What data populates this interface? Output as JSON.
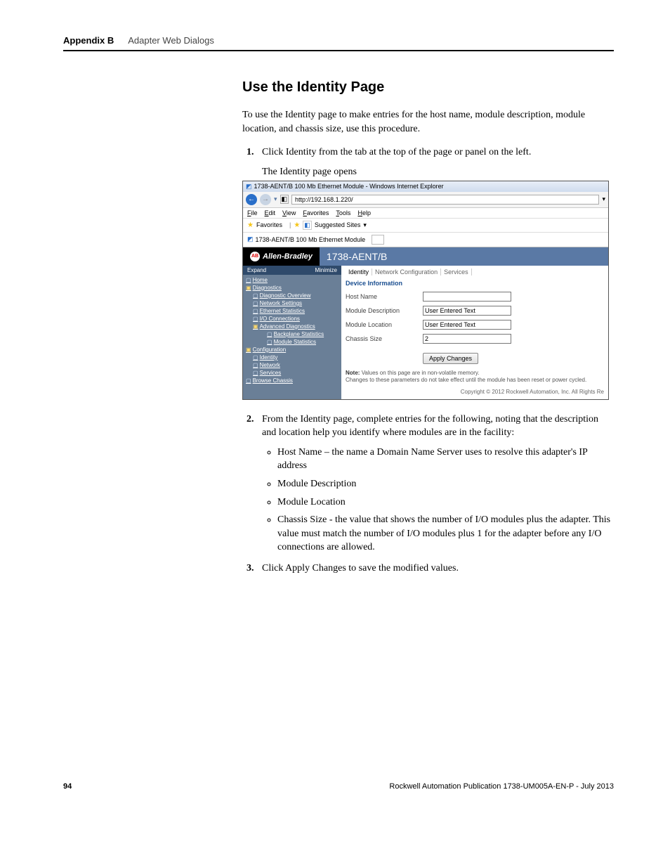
{
  "header": {
    "appendix": "Appendix B",
    "title": "Adapter Web Dialogs"
  },
  "section": {
    "heading": "Use the Identity Page",
    "intro": "To use the Identity page to make entries for the host name, module description, module location, and chassis size, use this procedure.",
    "step1": "Click Identity from the tab at the top of the page or panel on the left.",
    "caption": "The Identity page opens",
    "step2": "From the Identity page, complete entries for the following, noting that the description and location help you identify where modules are in the facility:",
    "bullets": {
      "b1": "Host Name – the name a Domain Name Server uses to resolve this adapter's IP address",
      "b2": "Module Description",
      "b3": "Module Location",
      "b4": "Chassis Size - the value that shows the number of I/O modules plus the adapter. This value must match the number of I/O modules plus 1 for the adapter before any I/O connections are allowed."
    },
    "step3": "Click Apply Changes to save the modified values."
  },
  "screenshot": {
    "window_title": "1738-AENT/B 100 Mb Ethernet Module - Windows Internet Explorer",
    "url": "http://192.168.1.220/",
    "menu": {
      "file": "File",
      "edit": "Edit",
      "view": "View",
      "favorites": "Favorites",
      "tools": "Tools",
      "help": "Help"
    },
    "favbar": {
      "label": "Favorites",
      "suggested": "Suggested Sites"
    },
    "tab_label": "1738-AENT/B 100 Mb Ethernet Module",
    "brand": {
      "left": "Allen-Bradley",
      "right": "1738-AENT/B"
    },
    "side": {
      "expand": "Expand",
      "minimize": "Minimize",
      "home": "Home",
      "diagnostics": "Diagnostics",
      "diag_overview": "Diagnostic Overview",
      "net_settings": "Network Settings",
      "eth_stats": "Ethernet Statistics",
      "io_conn": "I/O Connections",
      "adv_diag": "Advanced Diagnostics",
      "backplane": "Backplane Statistics",
      "mod_stats": "Module Statistics",
      "config": "Configuration",
      "identity": "Identity",
      "network": "Network",
      "services": "Services",
      "browse": "Browse Chassis"
    },
    "tabs": {
      "identity": "Identity",
      "netcfg": "Network Configuration",
      "services": "Services"
    },
    "fieldset": "Device Information",
    "form": {
      "host_name_lbl": "Host Name",
      "host_name_val": "",
      "mod_desc_lbl": "Module Description",
      "mod_desc_val": "User Entered Text",
      "mod_loc_lbl": "Module Location",
      "mod_loc_val": "User Entered Text",
      "chassis_lbl": "Chassis Size",
      "chassis_val": "2"
    },
    "apply": "Apply Changes",
    "note_label": "Note:",
    "note_1": "Values on this page are in non-volatile memory.",
    "note_2": "Changes to these parameters do not take effect until the module has been reset or power cycled.",
    "copyright": "Copyright © 2012 Rockwell Automation, Inc. All Rights Re"
  },
  "footer": {
    "page": "94",
    "pub": "Rockwell Automation Publication 1738-UM005A-EN-P - July 2013"
  }
}
